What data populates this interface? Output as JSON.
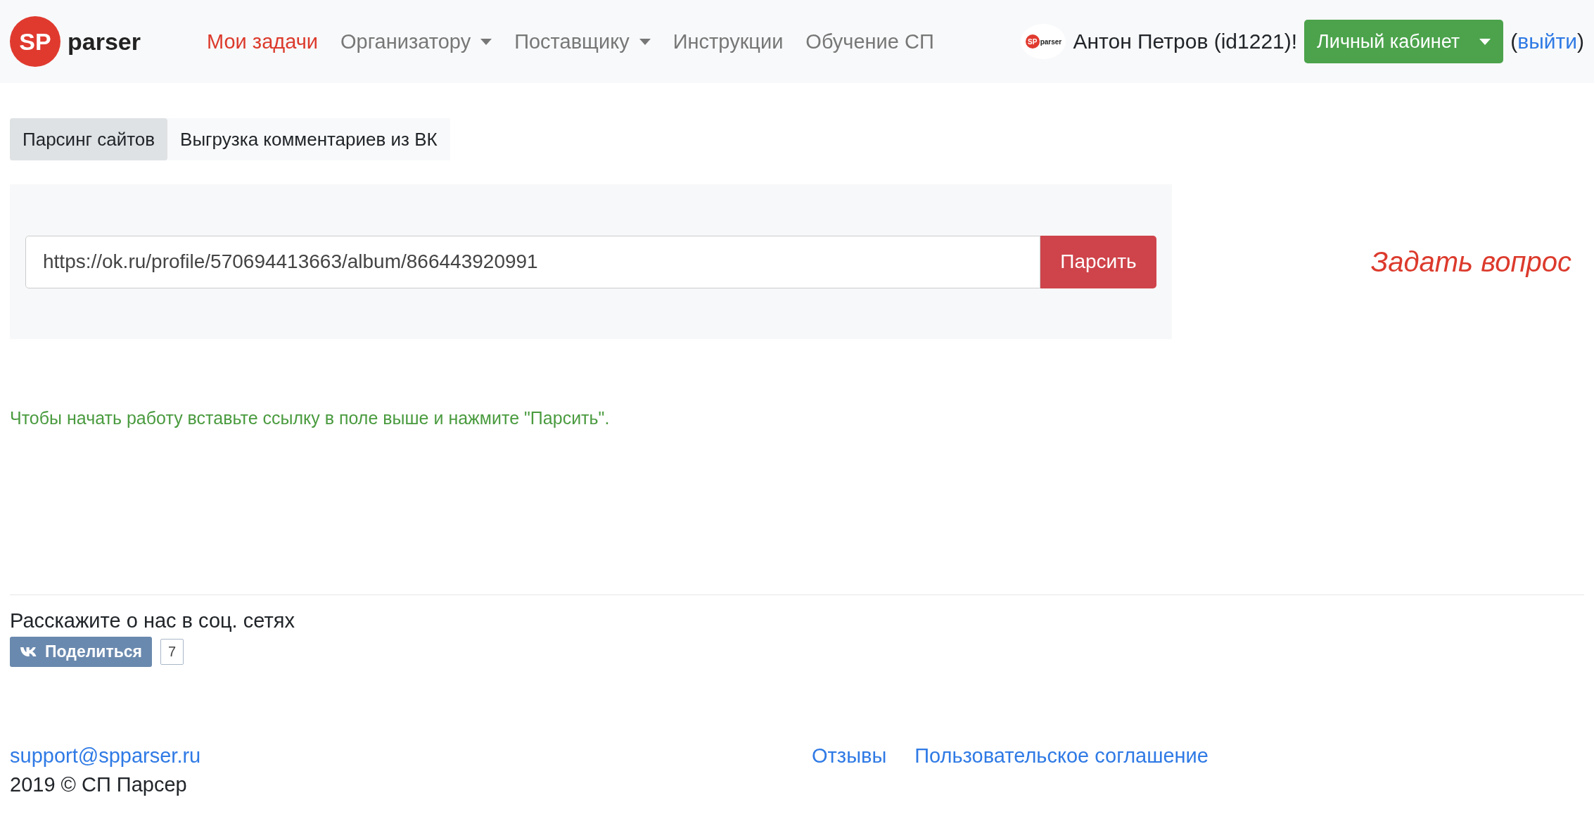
{
  "header": {
    "logo": {
      "mark": "SP",
      "name": "parser"
    },
    "nav": [
      {
        "label": "Мои задачи",
        "selected": true,
        "dropdown": false
      },
      {
        "label": "Организатору",
        "selected": false,
        "dropdown": true
      },
      {
        "label": "Поставщику",
        "selected": false,
        "dropdown": true
      },
      {
        "label": "Инструкции",
        "selected": false,
        "dropdown": false
      },
      {
        "label": "Обучение СП",
        "selected": false,
        "dropdown": false
      }
    ],
    "user": {
      "avatar": {
        "mark": "SP",
        "name": "parser"
      },
      "greeting": "Антон Петров (id1221)!",
      "cabinet_button": "Личный кабинет",
      "logout_open": "(",
      "logout_link": "выйти",
      "logout_close": ")"
    }
  },
  "tabs": [
    {
      "label": "Парсинг сайтов",
      "selected": true
    },
    {
      "label": "Выгрузка комментариев из ВК",
      "selected": false
    }
  ],
  "parse_form": {
    "value": "https://ok.ru/profile/570694413663/album/866443920991",
    "button": "Парсить"
  },
  "ask_link": "Задать вопрос",
  "hint": "Чтобы начать работу вставьте ссылку в поле выше и нажмите \"Парсить\".",
  "share": {
    "title": "Расскажите о нас в соц. сетях",
    "button": "Поделиться",
    "count": "7"
  },
  "footer": {
    "email": "support@spparser.ru",
    "copyright": "2019 © СП Парсер",
    "links": [
      "Отзывы",
      "Пользовательское соглашение"
    ]
  }
}
